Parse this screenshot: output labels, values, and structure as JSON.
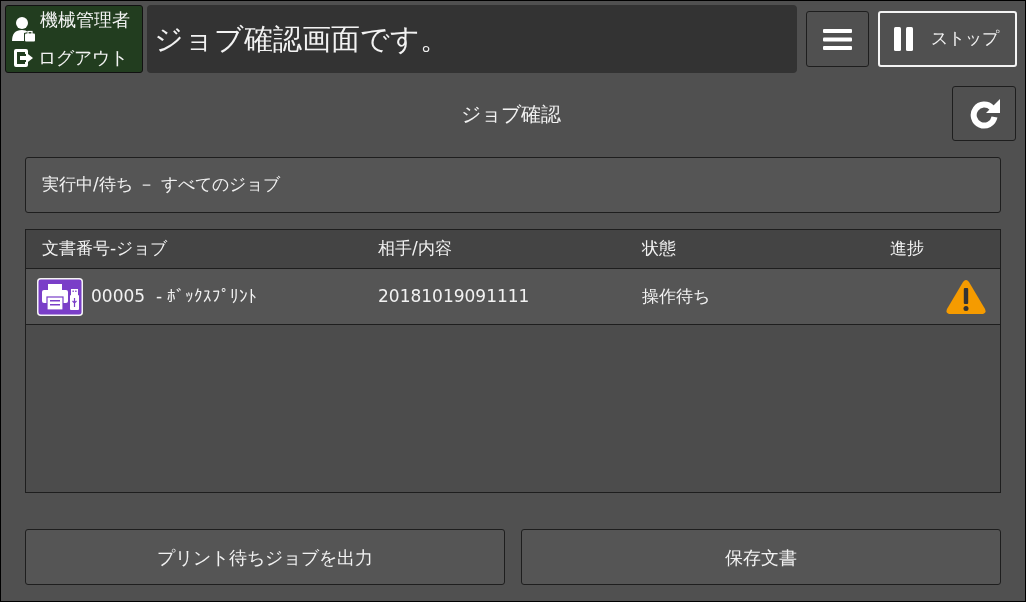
{
  "user_panel": {
    "user": "機械管理者",
    "logout": "ログアウト"
  },
  "message": "ジョブ確認画面です。",
  "stop_button": {
    "label": "ストップ"
  },
  "title": "ジョブ確認",
  "filter": {
    "label": "実行中/待ち － すべてのジョブ"
  },
  "table": {
    "columns": [
      "文書番号-ジョブ",
      "相手/内容",
      "状態",
      "進捗"
    ],
    "rows": [
      {
        "job": "00005  - ﾎﾞｯｸｽﾌﾟﾘﾝﾄ",
        "destination": "20181019091111",
        "status": "操作待ち",
        "warning": true
      }
    ]
  },
  "buttons": [
    "プリント待ちジョブを出力",
    "保存文書"
  ]
}
